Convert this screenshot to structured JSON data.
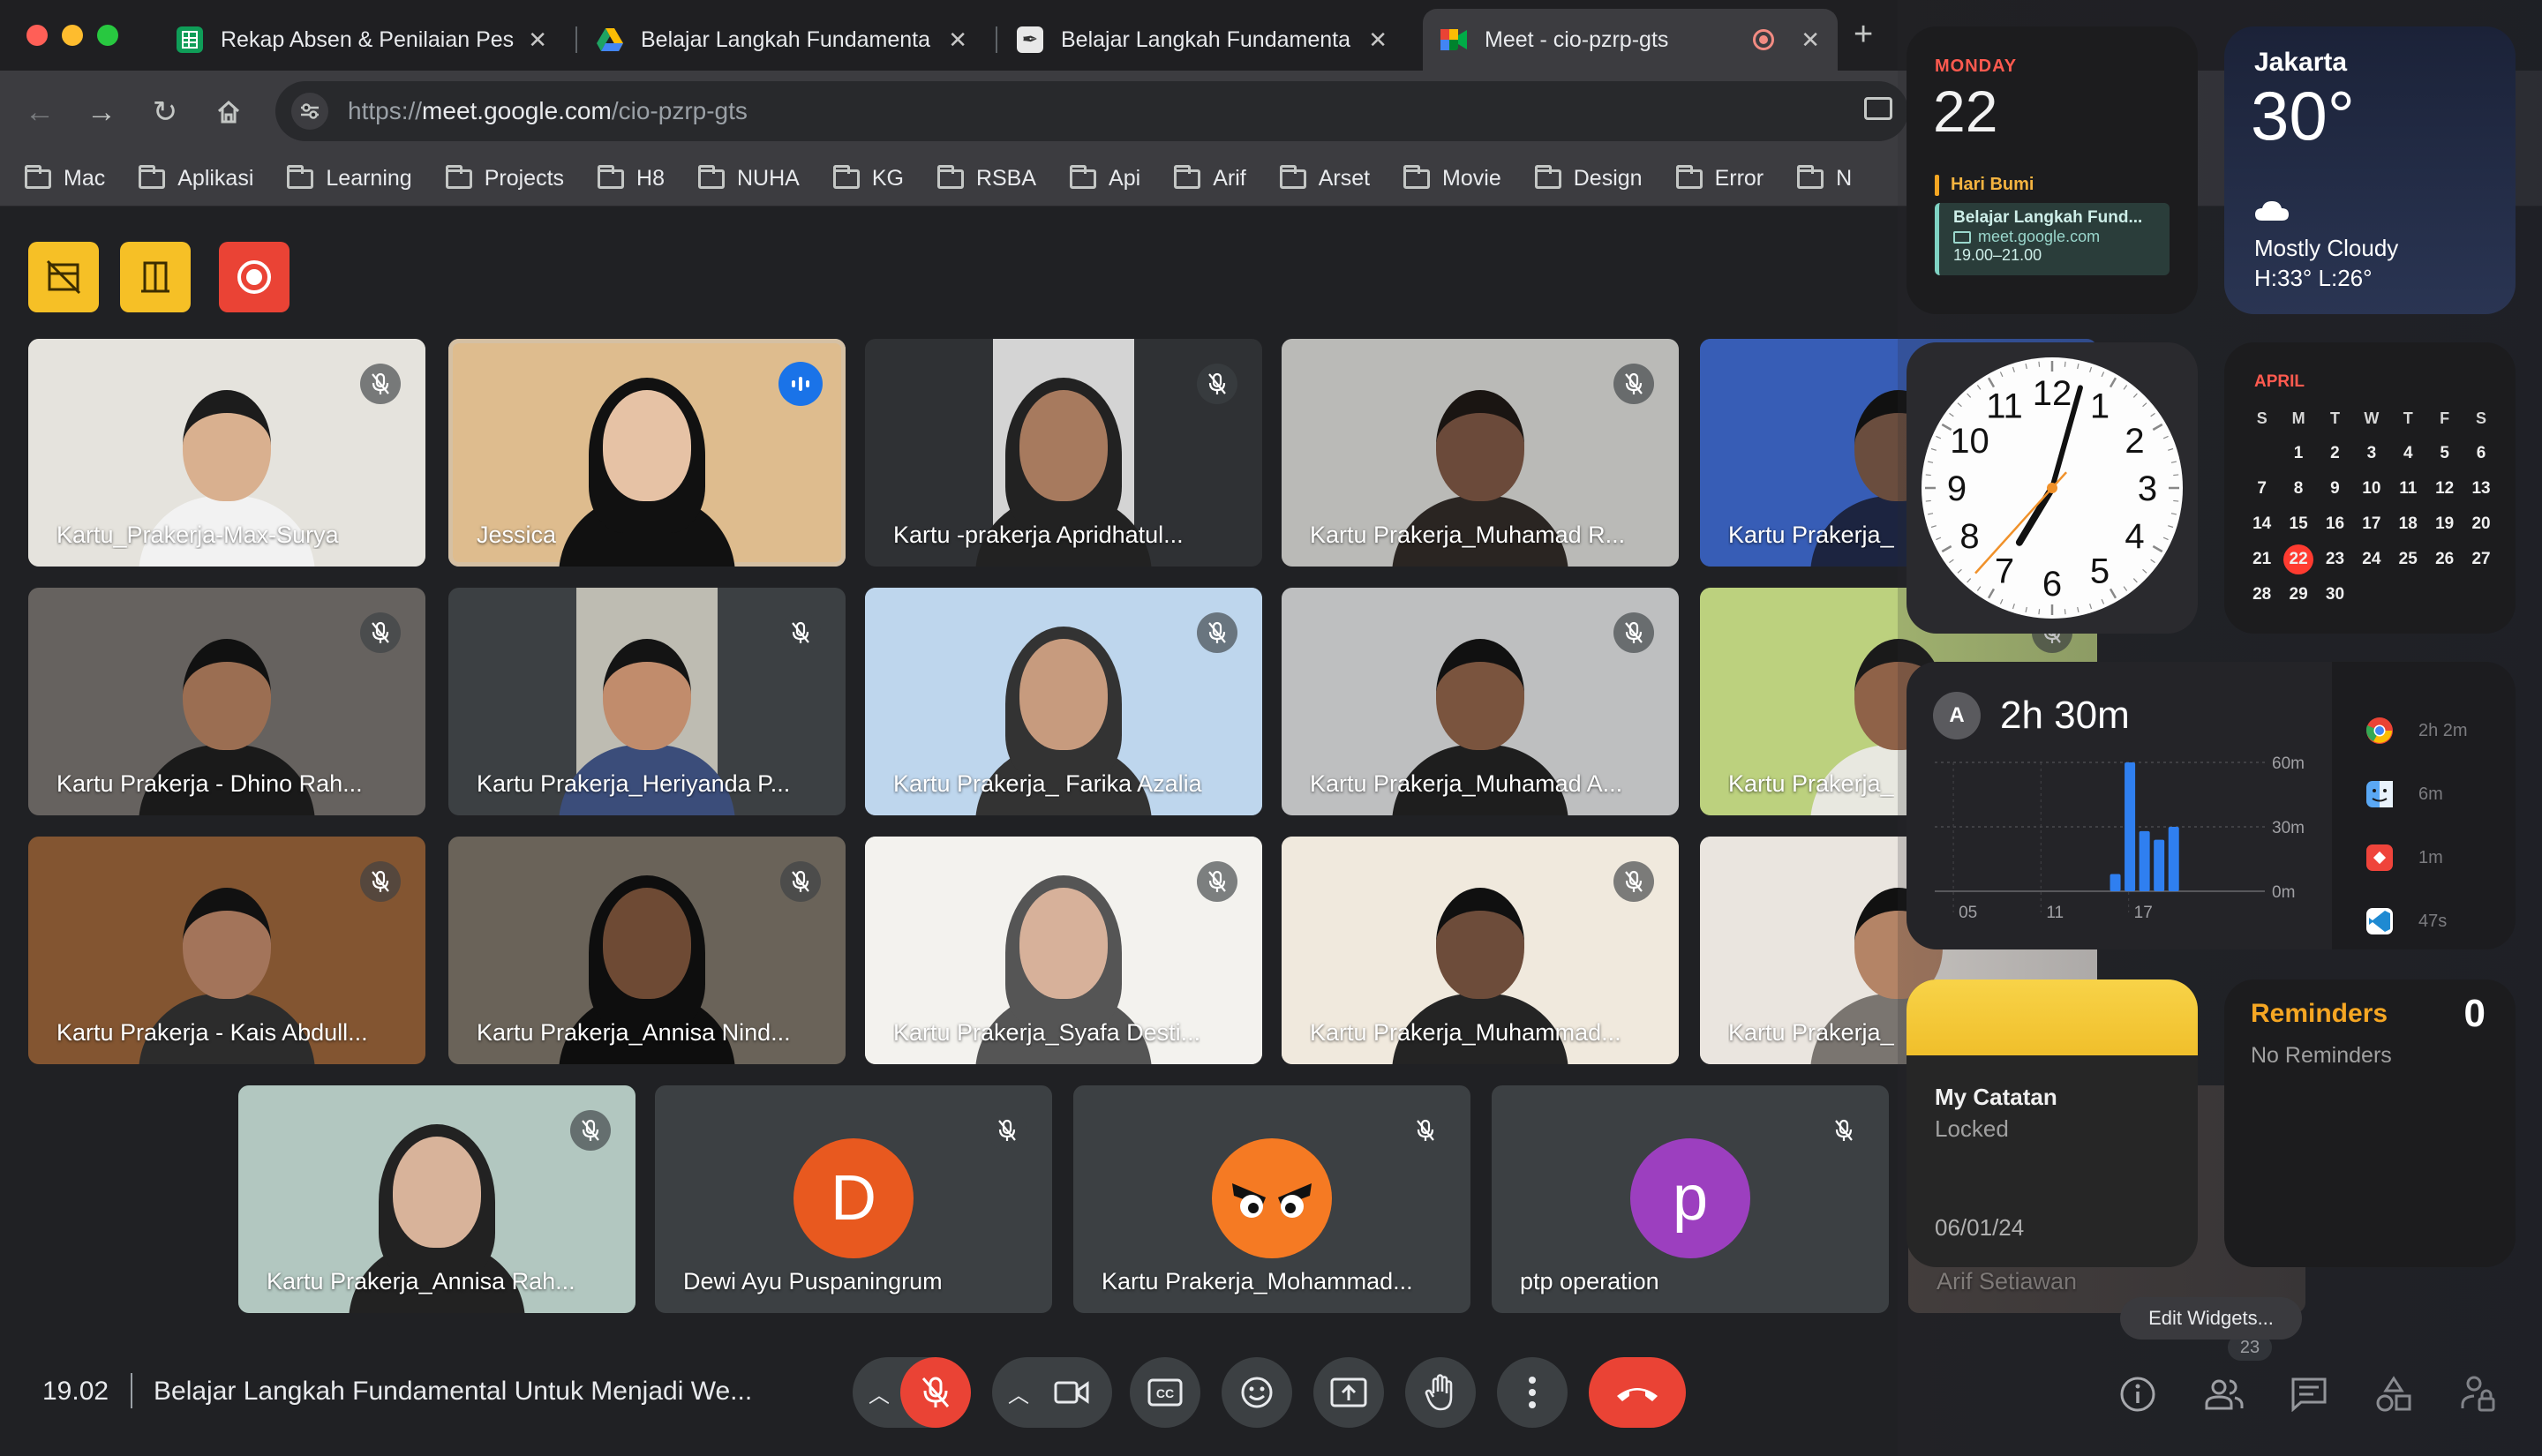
{
  "browser": {
    "tabs": [
      {
        "title": "Rekap Absen & Penilaian Pes",
        "favicon": "sheets-icon",
        "favicon_color": "#0f9d58"
      },
      {
        "title": "Belajar Langkah Fundamenta",
        "favicon": "drive-icon",
        "favicon_color": "#fbbc04"
      },
      {
        "title": "Belajar Langkah Fundamenta",
        "favicon": "feather-icon",
        "favicon_color": "#333333"
      },
      {
        "title": "Meet - cio-pzrp-gts",
        "favicon": "meet-icon",
        "favicon_color": "#00832d",
        "active": true,
        "recording": true
      }
    ],
    "new_tab": "+",
    "url_scheme": "https://",
    "url_host": "meet.google.com",
    "url_path": "/cio-pzrp-gts",
    "bookmarks": [
      "Mac",
      "Aplikasi",
      "Learning",
      "Projects",
      "H8",
      "NUHA",
      "KG",
      "RSBA",
      "Api",
      "Arif",
      "Arset",
      "Movie",
      "Design",
      "Error",
      "N"
    ]
  },
  "meet": {
    "host_controls": [
      "host-controls-icon",
      "companion-mode-icon",
      "recording-icon"
    ],
    "participants": [
      {
        "name": "Kartu_Prakerja-Max-Surya",
        "muted": true
      },
      {
        "name": "Jessica",
        "muted": false,
        "speaking": true
      },
      {
        "name": "Kartu -prakerja Apridhatul...",
        "muted": true
      },
      {
        "name": "Kartu Prakerja_Muhamad R...",
        "muted": true
      },
      {
        "name": "Kartu Prakerja_",
        "muted": true
      },
      {
        "name": "Kartu Prakerja - Dhino Rah...",
        "muted": true
      },
      {
        "name": "Kartu Prakerja_Heriyanda P...",
        "muted": true
      },
      {
        "name": "Kartu Prakerja_ Farika Azalia",
        "muted": true
      },
      {
        "name": "Kartu Prakerja_Muhamad A...",
        "muted": true
      },
      {
        "name": "Kartu Prakerja_",
        "muted": true
      },
      {
        "name": "Kartu Prakerja - Kais Abdull...",
        "muted": true
      },
      {
        "name": "Kartu Prakerja_Annisa Nind...",
        "muted": true
      },
      {
        "name": "Kartu Prakerja_Syafa Desti...",
        "muted": true
      },
      {
        "name": "Kartu Prakerja_Muhammad...",
        "muted": true
      },
      {
        "name": "Kartu Prakerja_",
        "muted": true
      },
      {
        "name": "Kartu Prakerja_Annisa Rah...",
        "muted": true
      },
      {
        "name": "Dewi Ayu Puspaningrum",
        "muted": true,
        "avatar_letter": "D",
        "avatar_color": "#e8591f"
      },
      {
        "name": "Kartu Prakerja_Mohammad...",
        "muted": true,
        "avatar_color": "#f57a23"
      },
      {
        "name": "ptp operation",
        "muted": true,
        "avatar_letter": "p",
        "avatar_color": "#9c3fbf"
      }
    ],
    "partial_label": "Arif Setiawan",
    "time": "19.02",
    "meeting_title": "Belajar Langkah Fundamental Untuk Menjadi We...",
    "participant_count": "23",
    "end_call_color": "#ea4335"
  },
  "widgets": {
    "calendar_day": {
      "weekday": "MONDAY",
      "day": "22",
      "holiday": "Hari Bumi",
      "event_title": "Belajar Langkah Fund...",
      "event_location": "meet.google.com",
      "event_time": "19.00–21.00"
    },
    "weather": {
      "city": "Jakarta",
      "temp": "30°",
      "condition": "Mostly Cloudy",
      "hilo": "H:33° L:26°"
    },
    "clock": {
      "numbers": [
        "12",
        "1",
        "2",
        "3",
        "4",
        "5",
        "6",
        "7",
        "8",
        "9",
        "10",
        "11"
      ],
      "hour": 7,
      "minute": 2,
      "second": 37
    },
    "calendar_month": {
      "month": "APRIL",
      "weekdays": [
        "S",
        "M",
        "T",
        "W",
        "T",
        "F",
        "S"
      ],
      "weeks": [
        [
          "",
          "1",
          "2",
          "3",
          "4",
          "5",
          "6"
        ],
        [
          "7",
          "8",
          "9",
          "10",
          "11",
          "12",
          "13"
        ],
        [
          "14",
          "15",
          "16",
          "17",
          "18",
          "19",
          "20"
        ],
        [
          "21",
          "22",
          "23",
          "24",
          "25",
          "26",
          "27"
        ],
        [
          "28",
          "29",
          "30",
          "",
          "",
          "",
          ""
        ]
      ],
      "today": "22",
      "today_color": "#ff3b30"
    },
    "screen_time": {
      "avatar": "A",
      "total": "2h 30m",
      "y_labels": [
        "60m",
        "30m",
        "0m"
      ],
      "x_labels": [
        "05",
        "11",
        "17"
      ],
      "bars": [
        {
          "hour": 15,
          "minutes": 8
        },
        {
          "hour": 16,
          "minutes": 60
        },
        {
          "hour": 17,
          "minutes": 28
        },
        {
          "hour": 18,
          "minutes": 24
        },
        {
          "hour": 19,
          "minutes": 30
        }
      ],
      "apps": [
        {
          "icon": "chrome-icon",
          "time": "2h 2m"
        },
        {
          "icon": "finder-icon",
          "time": "6m"
        },
        {
          "icon": "anydesk-icon",
          "time": "1m"
        },
        {
          "icon": "vscode-icon",
          "time": "47s"
        }
      ]
    },
    "notes": {
      "title": "My Catatan",
      "status": "Locked",
      "date": "06/01/24"
    },
    "reminders": {
      "title": "Reminders",
      "count": "0",
      "empty": "No Reminders"
    },
    "edit_label": "Edit Widgets..."
  }
}
